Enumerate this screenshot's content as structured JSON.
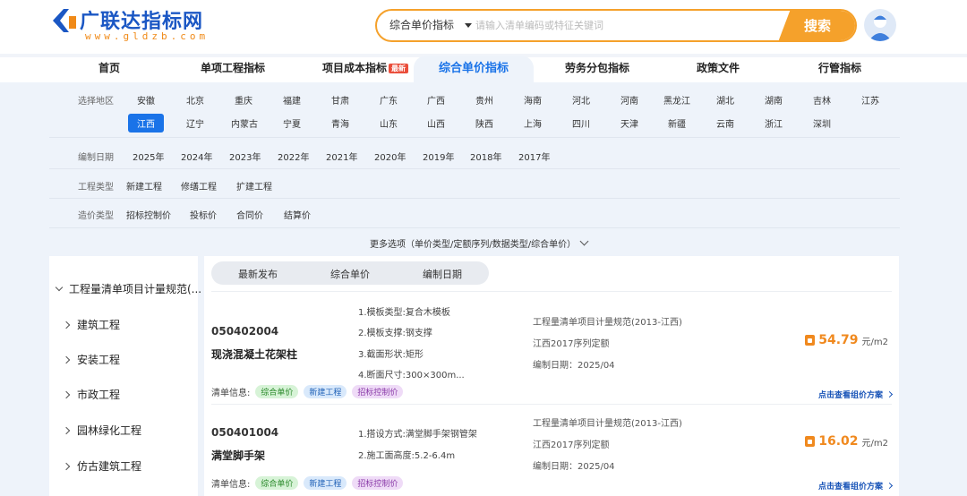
{
  "brand": {
    "name": "广联达指标网",
    "url": "www.gldzb.com",
    "primary_color": "#1b57c4",
    "accent_color": "#f5a12b"
  },
  "search": {
    "type_label": "综合单价指标",
    "placeholder": "请输入清单编码或特征关键词",
    "button_label": "搜索"
  },
  "nav": {
    "items": [
      {
        "label": "首页"
      },
      {
        "label": "单项工程指标"
      },
      {
        "label": "项目成本指标",
        "badge": "最新"
      },
      {
        "label": "综合单价指标",
        "active": true
      },
      {
        "label": "劳务分包指标"
      },
      {
        "label": "政策文件"
      },
      {
        "label": "行管指标"
      }
    ]
  },
  "filters": {
    "region": {
      "label": "选择地区",
      "row1": [
        "安徽",
        "北京",
        "重庆",
        "福建",
        "甘肃",
        "广东",
        "广西",
        "贵州",
        "海南",
        "河北",
        "河南",
        "黑龙江",
        "湖北",
        "湖南",
        "吉林",
        "江苏"
      ],
      "row2": [
        "江西",
        "辽宁",
        "内蒙古",
        "宁夏",
        "青海",
        "山东",
        "山西",
        "陕西",
        "上海",
        "四川",
        "天津",
        "新疆",
        "云南",
        "浙江",
        "深圳"
      ],
      "selected": "江西"
    },
    "date": {
      "label": "编制日期",
      "options": [
        "2025年",
        "2024年",
        "2023年",
        "2022年",
        "2021年",
        "2020年",
        "2019年",
        "2018年",
        "2017年"
      ]
    },
    "project_type": {
      "label": "工程类型",
      "options": [
        "新建工程",
        "修缮工程",
        "扩建工程"
      ]
    },
    "cost_type": {
      "label": "造价类型",
      "options": [
        "招标控制价",
        "投标价",
        "合同价",
        "结算价"
      ]
    },
    "more_label": "更多选项（单价类型/定额序列/数据类型/综合单价）"
  },
  "sidebar": {
    "root": "工程量清单项目计量规范(...",
    "items": [
      "建筑工程",
      "安装工程",
      "市政工程",
      "园林绿化工程",
      "仿古建筑工程"
    ]
  },
  "list": {
    "sort_tabs": [
      "最新发布",
      "综合单价",
      "编制日期"
    ],
    "tags_label": "清单信息:",
    "link_label": "点击查看组价方案",
    "items": [
      {
        "code": "050402004",
        "name": "现浇混凝土花架柱",
        "features": [
          "1.模板类型:复合木模板",
          "2.模板支撑:钢支撑",
          "3.截面形状:矩形",
          "4.断面尺寸:300×300m..."
        ],
        "spec": "工程量清单项目计量规范(2013-江西)",
        "quota": "江西2017序列定额",
        "date": "编制日期：2025/04",
        "price": "54.79",
        "unit": "元/m2",
        "tags": [
          "综合单价",
          "新建工程",
          "招标控制价"
        ]
      },
      {
        "code": "050401004",
        "name": "满堂脚手架",
        "features": [
          "1.搭设方式:满堂脚手架钢管架",
          "2.施工面高度:5.2-6.4m"
        ],
        "spec": "工程量清单项目计量规范(2013-江西)",
        "quota": "江西2017序列定额",
        "date": "编制日期：2025/04",
        "price": "16.02",
        "unit": "元/m2",
        "tags": [
          "综合单价",
          "新建工程",
          "招标控制价"
        ]
      }
    ]
  }
}
